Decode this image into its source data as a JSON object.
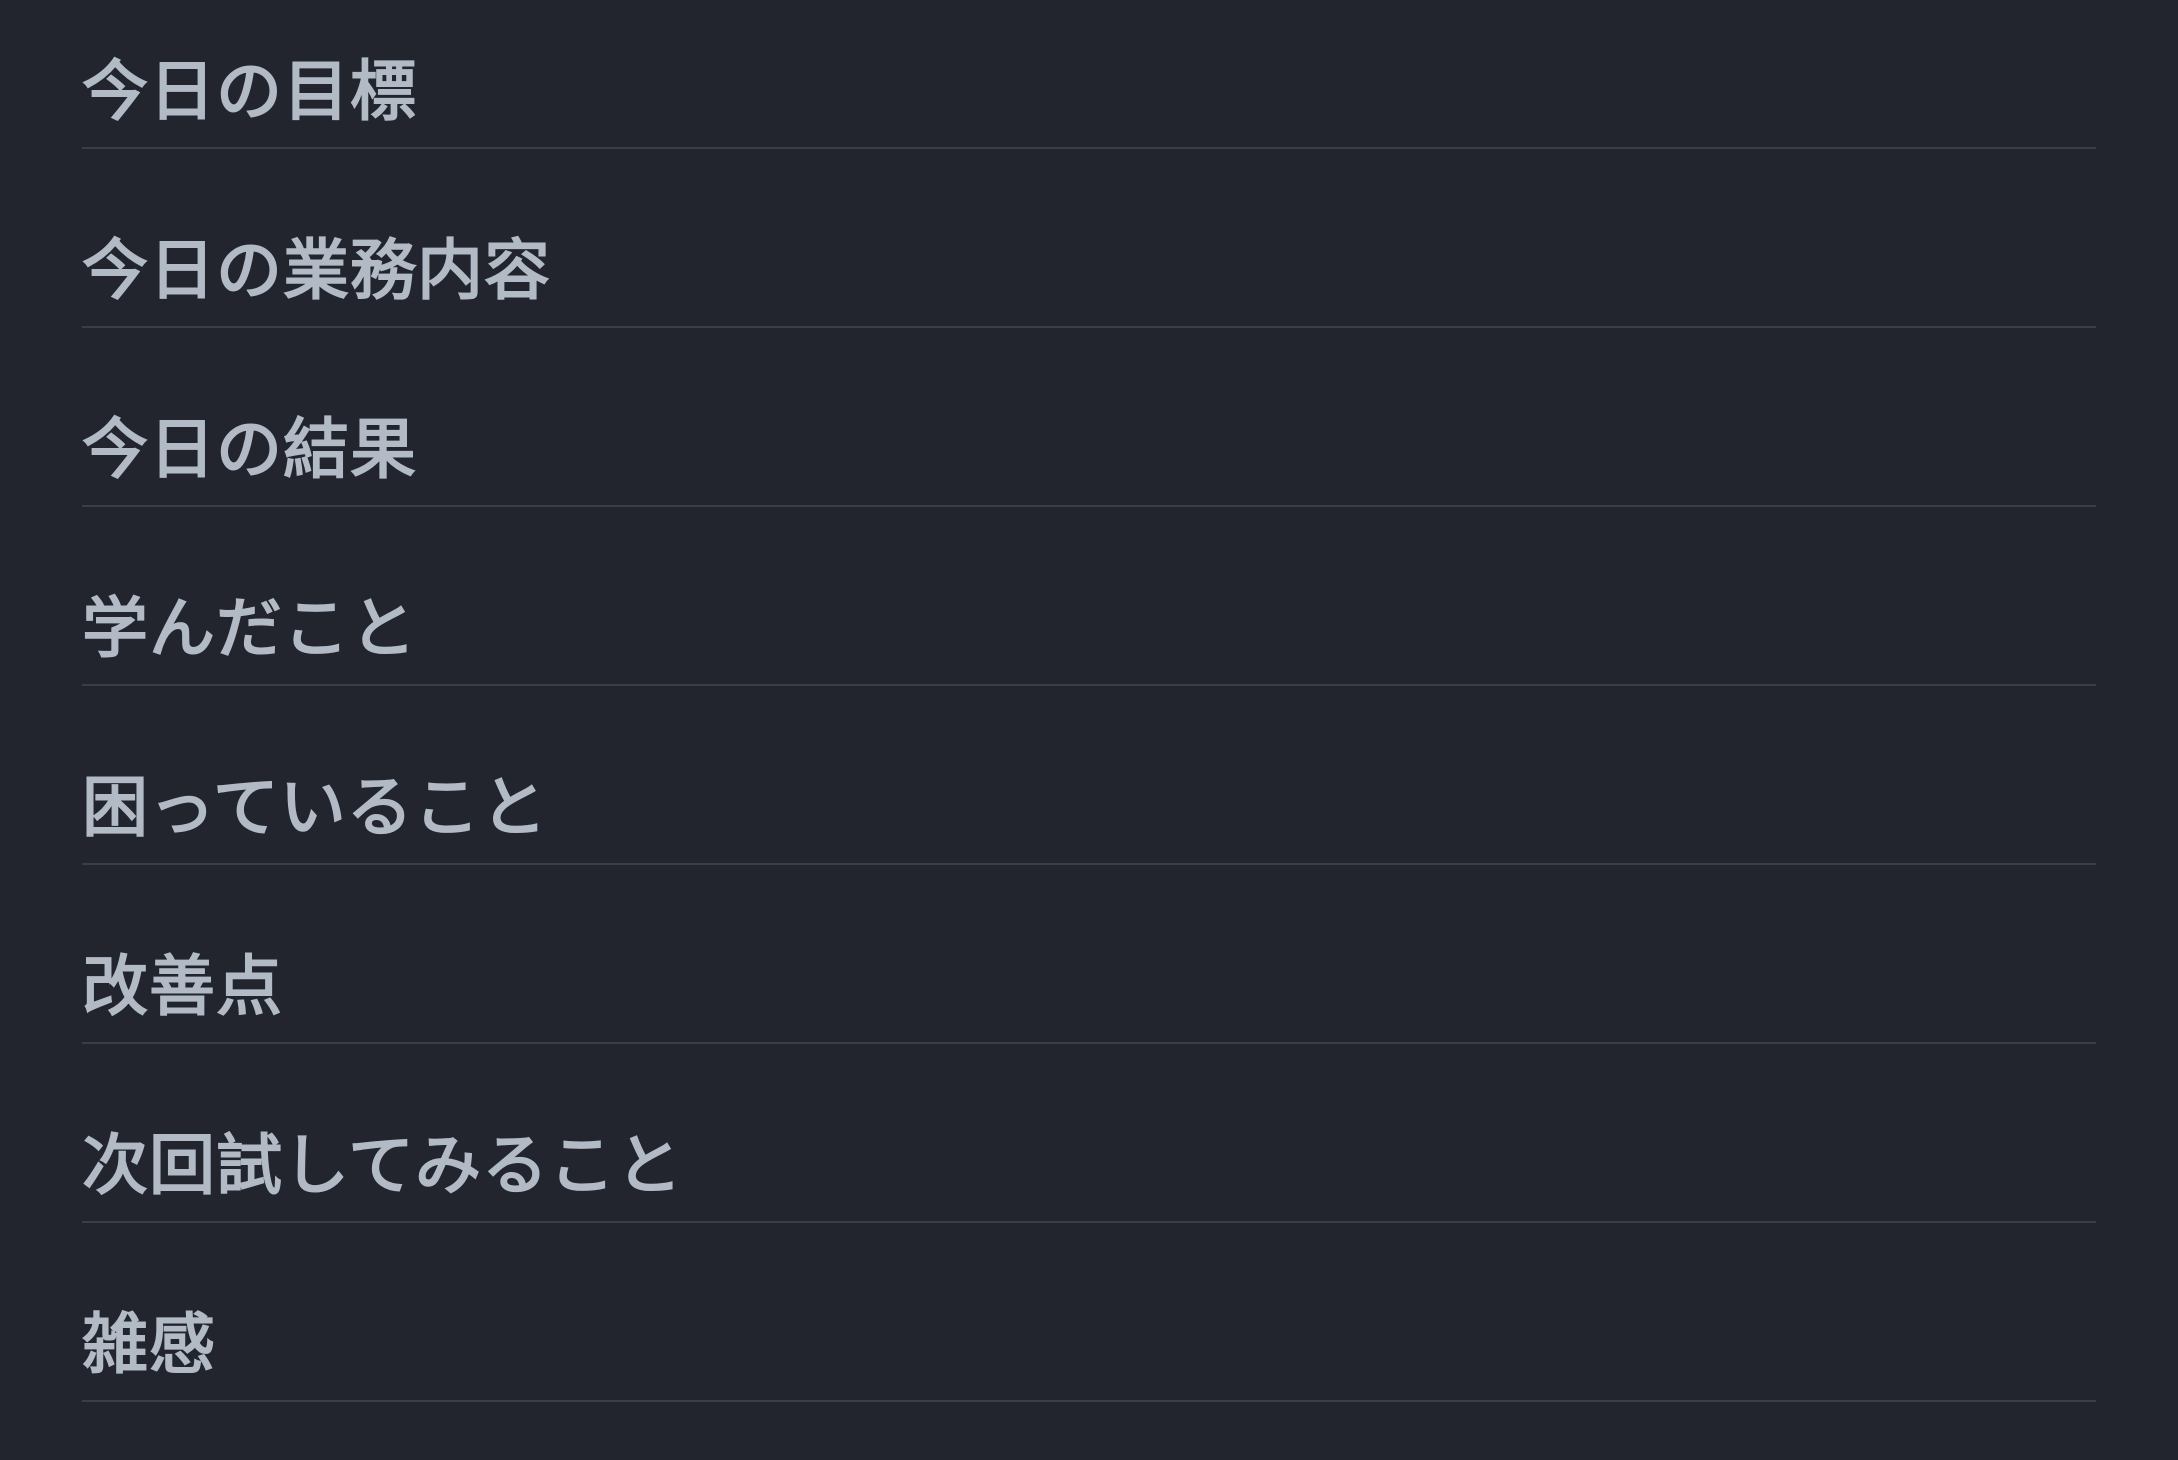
{
  "document": {
    "headings": [
      "今日の目標",
      "今日の業務内容",
      "今日の結果",
      "学んだこと",
      "困っていること",
      "改善点",
      "次回試してみること",
      "雑感"
    ]
  },
  "colors": {
    "background": "#22252d",
    "heading_text": "#b2bac6",
    "divider": "#3a3e47"
  }
}
